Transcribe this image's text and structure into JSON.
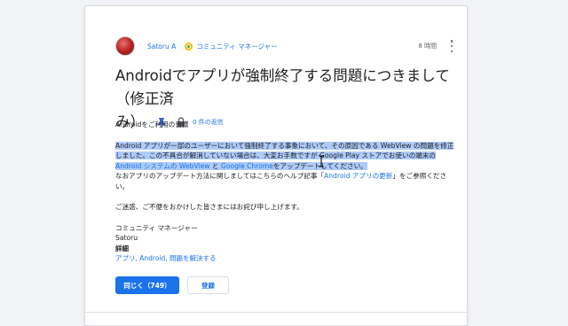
{
  "post": {
    "author": "Satoru A",
    "role": "コミュニティ マネージャー",
    "time": "8 時間",
    "title": "Androidでアプリが強制終了する問題につきまして（修正済み）",
    "title_line1": "Androidでアプリが強制終了する問題につきまして（修正済",
    "title_line2": "み）",
    "replies": "0 件の返信"
  },
  "body": {
    "greeting": "Androidをご利用の皆様",
    "para1_line1": "Android アプリが一部のユーザーにおいて強制終了する事象において、その原因である WebView の問題を修正",
    "para1_line2_a": "しました。この不具合が解消していない場合は、大変お手数ですが Google Play ストアでお使いの端末の",
    "para1_line3_link1": "Android システムの WebView",
    "para1_line3_mid": " と ",
    "para1_line3_link2": "Google Chrome",
    "para1_line3_end": "をアップデートしてください。",
    "para1_line4_a": "なおアプリのアップデート方法に関しましてはこちらのヘルプ記事「",
    "para1_line4_link": "Android アプリの更新",
    "para1_line4_b": "」をご参照くださ",
    "para1_line5": "い。",
    "apology": "ご迷惑、ご不便をおかけした皆さまにはお詫び申し上げます。",
    "sign_role": "コミュニティ マネージャー",
    "sign_name": "Satoru"
  },
  "details": {
    "label": "詳細",
    "tags": "アプリ, Android, 問題を解決する"
  },
  "actions": {
    "same_label": "同じく（749）",
    "register_label": "登録"
  },
  "colors": {
    "accent": "#1a73e8",
    "highlight": "#aecbfa"
  },
  "icons": [
    "more-vert-icon",
    "pin-icon",
    "lock-icon",
    "community-manager-badge-icon",
    "text-cursor-icon"
  ]
}
